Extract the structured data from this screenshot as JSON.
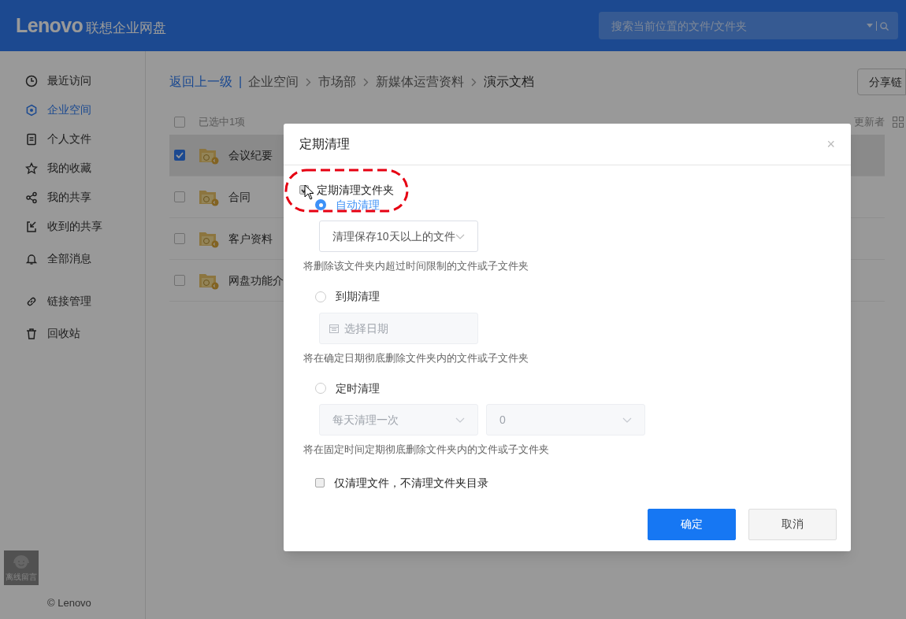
{
  "header": {
    "logo": "Lenovo",
    "product": "联想企业网盘",
    "search": {
      "placeholder": "搜索当前位置的文件/文件夹"
    }
  },
  "sidebar": {
    "items": [
      {
        "label": "最近访问",
        "selected": false
      },
      {
        "label": "企业空间",
        "selected": true
      },
      {
        "label": "个人文件",
        "selected": false
      },
      {
        "label": "我的收藏",
        "selected": false
      },
      {
        "label": "我的共享",
        "selected": false
      },
      {
        "label": "收到的共享",
        "selected": false
      },
      {
        "label": "全部消息",
        "selected": false
      },
      {
        "label": "链接管理",
        "selected": false
      },
      {
        "label": "回收站",
        "selected": false
      }
    ],
    "support": "离线留言",
    "copyright": "© Lenovo"
  },
  "breadcrumb": {
    "back": "返回上一级",
    "separator": "|",
    "path": [
      "企业空间",
      "市场部",
      "新媒体运营资料",
      "演示文档"
    ]
  },
  "share_button": "分享链",
  "table": {
    "header": {
      "select_all_checked": false,
      "selection": "已选中1项",
      "column_updater": "更新者"
    },
    "rows": [
      {
        "name": "会议纪要",
        "checked": true,
        "selected": true
      },
      {
        "name": "合同",
        "checked": false,
        "selected": false
      },
      {
        "name": "客户资料",
        "checked": false,
        "selected": false
      },
      {
        "name": "网盘功能介",
        "checked": false,
        "selected": false
      }
    ]
  },
  "dialog": {
    "title": "定期清理",
    "close": "×",
    "enable": {
      "label": "定期清理文件夹",
      "checked": true
    },
    "options": [
      {
        "label": "自动清理",
        "selected": true,
        "controls": [
          {
            "kind": "select",
            "value": "清理保存10天以上的文件",
            "disabled": false
          }
        ],
        "note": "将删除该文件夹内超过时间限制的文件或子文件夹"
      },
      {
        "label": "到期清理",
        "selected": false,
        "controls": [
          {
            "kind": "date",
            "placeholder": "选择日期",
            "disabled": true
          }
        ],
        "note": "将在确定日期彻底删除文件夹内的文件或子文件夹"
      },
      {
        "label": "定时清理",
        "selected": false,
        "controls": [
          {
            "kind": "select",
            "value": "每天清理一次",
            "disabled": true
          },
          {
            "kind": "select",
            "value": "0",
            "disabled": true
          }
        ],
        "note": "将在固定时间定期彻底删除文件夹内的文件或子文件夹"
      }
    ],
    "files_only": {
      "label": "仅清理文件，不清理文件夹目录",
      "checked": false
    },
    "buttons": [
      {
        "label": "确定",
        "kind": "primary"
      },
      {
        "label": "取消",
        "kind": "default"
      }
    ]
  }
}
